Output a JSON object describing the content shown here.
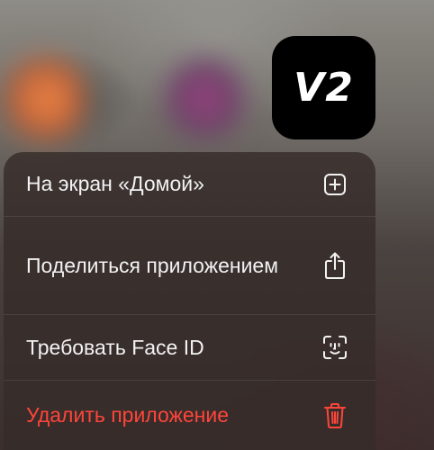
{
  "app_icon": {
    "text": "V2"
  },
  "menu": {
    "items": [
      {
        "label": "На экран «Домой»",
        "icon": "plus-square-icon",
        "destructive": false
      },
      {
        "label": "Поделиться приложением",
        "icon": "share-icon",
        "destructive": false
      },
      {
        "label": "Требовать Face ID",
        "icon": "face-id-icon",
        "destructive": false
      },
      {
        "label": "Удалить приложение",
        "icon": "trash-icon",
        "destructive": true
      }
    ]
  },
  "colors": {
    "menu_text": "#f2f2f2",
    "destructive": "#ff453a",
    "app_icon_bg": "#000000"
  }
}
